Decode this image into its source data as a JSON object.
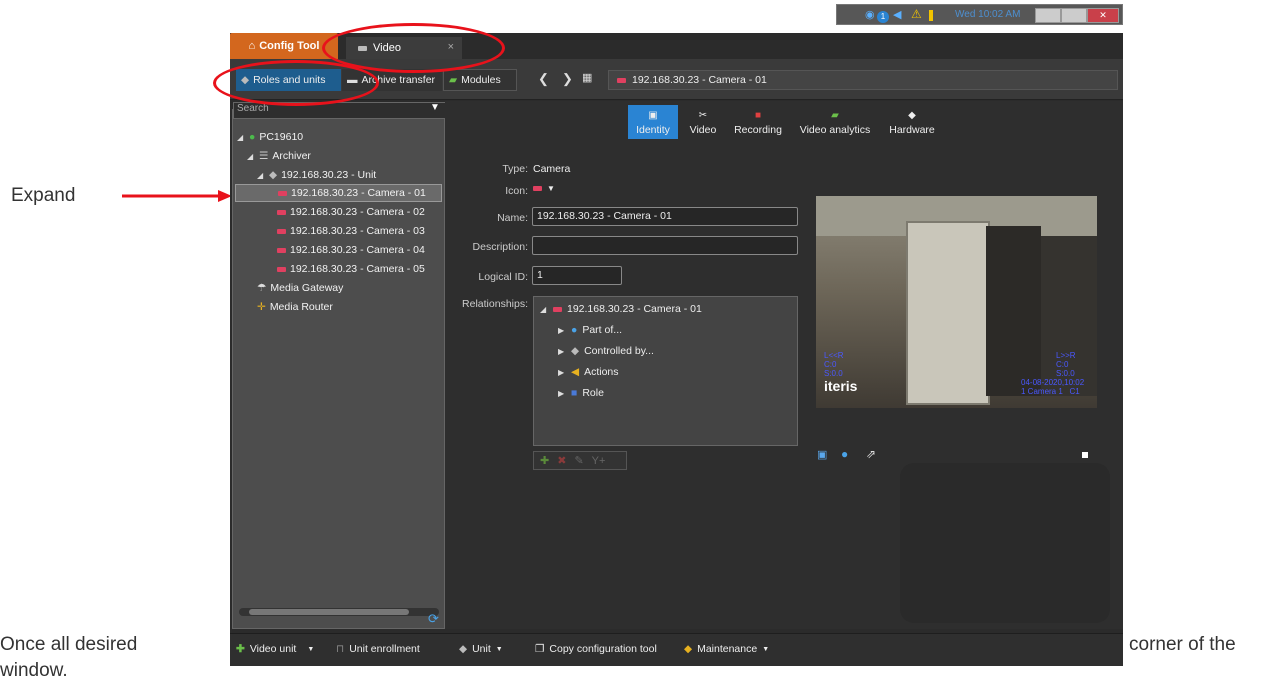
{
  "caption": {
    "expand_label": "Expand",
    "bottom_text_left": "Once all desired",
    "bottom_text_right": "corner of the",
    "bottom_text_line2": "window."
  },
  "taskbar": {
    "clock": "Wed 10:02 AM",
    "badge": "1"
  },
  "tabs": {
    "config_tool": "Config Tool",
    "video": "Video",
    "close": "×"
  },
  "toolbar": {
    "roles_units": "Roles and units",
    "archive_transfer": "Archive transfer",
    "modules": "Modules",
    "path": "192.168.30.23 - Camera - 01"
  },
  "search": {
    "placeholder": "Search"
  },
  "tree": {
    "root": "PC19610",
    "archiver": "Archiver",
    "unit": "192.168.30.23 - Unit",
    "cameras": [
      "192.168.30.23 - Camera - 01",
      "192.168.30.23 - Camera - 02",
      "192.168.30.23 - Camera - 03",
      "192.168.30.23 - Camera - 04",
      "192.168.30.23 - Camera - 05"
    ],
    "media_gateway": "Media Gateway",
    "media_router": "Media Router"
  },
  "page_tabs": [
    "Identity",
    "Video",
    "Recording",
    "Video analytics",
    "Hardware"
  ],
  "identity": {
    "type_label": "Type:",
    "type_value": "Camera",
    "icon_label": "Icon:",
    "name_label": "Name:",
    "name_value": "192.168.30.23 - Camera - 01",
    "description_label": "Description:",
    "description_value": "",
    "logical_id_label": "Logical ID:",
    "logical_id_value": "1",
    "relationships_label": "Relationships:"
  },
  "relationships": {
    "root": "192.168.30.23 - Camera - 01",
    "items": [
      "Part of...",
      "Controlled by...",
      "Actions",
      "Role"
    ]
  },
  "video_overlay": {
    "brand": "iteris",
    "datetime": "04-08-2020,10:02",
    "camera": "1 Camera 1",
    "channel": "C1",
    "left_codes": [
      "L<<R",
      "C:0",
      "S:0.0"
    ],
    "right_codes": [
      "L>>R",
      "C:0",
      "S:0.0"
    ]
  },
  "bottom_bar": {
    "video_unit": "Video unit",
    "unit_enrollment": "Unit enrollment",
    "unit": "Unit",
    "copy_config": "Copy configuration tool",
    "maintenance": "Maintenance"
  },
  "colors": {
    "accent_blue": "#2a84d3",
    "config_tab_orange": "#d3671e",
    "annotation_red": "#e8121b"
  }
}
